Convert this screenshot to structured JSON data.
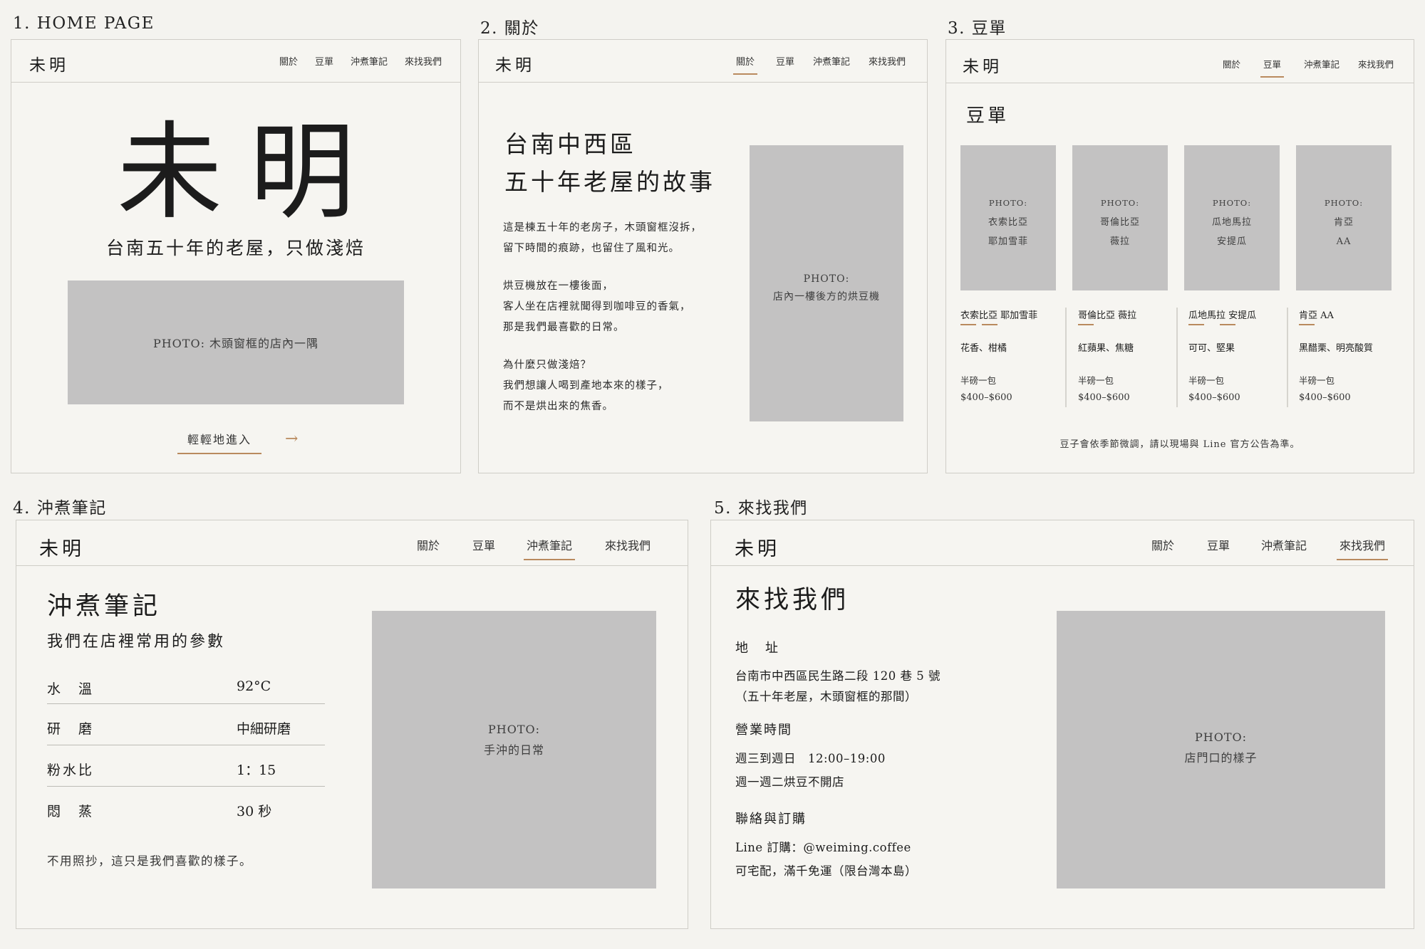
{
  "accent_color": "#b98a5e",
  "photo_color": "#c3c2c2",
  "panels": {
    "home": {
      "title": "1. HOME PAGE",
      "logo": "未明",
      "nav": [
        "關於",
        "豆單",
        "沖煮筆記",
        "來找我們"
      ],
      "hero_title": "未明",
      "hero_subtitle": "台南五十年的老屋，只做淺焙",
      "photo": "PHOTO: 木頭窗框的店內一隅",
      "enter_link": "輕輕地進入",
      "arrow_icon": "→"
    },
    "about": {
      "title": "2. 關於",
      "logo": "未明",
      "nav": [
        "關於",
        "豆單",
        "沖煮筆記",
        "來找我們"
      ],
      "heading": [
        "台南中西區",
        "五十年老屋的故事"
      ],
      "paragraphs": [
        [
          "這是棟五十年的老房子，木頭窗框沒拆，",
          "留下時間的痕跡，也留住了風和光。"
        ],
        [
          "烘豆機放在一樓後面，",
          "客人坐在店裡就聞得到咖啡豆的香氣，",
          "那是我們最喜歡的日常。"
        ],
        [
          "為什麼只做淺焙？",
          "我們想讓人喝到產地本來的樣子，",
          "而不是烘出來的焦香。"
        ]
      ],
      "photo": [
        "PHOTO:",
        "店內一樓後方的烘豆機"
      ]
    },
    "beans": {
      "title": "3. 豆單",
      "logo": "未明",
      "nav": [
        "關於",
        "豆單",
        "沖煮筆記",
        "來找我們"
      ],
      "heading": "豆單",
      "items": [
        {
          "photo": [
            "PHOTO:",
            "衣索比亞",
            "耶加雪菲"
          ],
          "name": "衣索比亞 耶加雪菲",
          "notes": "花香、柑橘",
          "size": "半磅一包",
          "price": "$400–$600"
        },
        {
          "photo": [
            "PHOTO:",
            "哥倫比亞",
            "薇拉"
          ],
          "name": "哥倫比亞 薇拉",
          "notes": "紅蘋果、焦糖",
          "size": "半磅一包",
          "price": "$400–$600"
        },
        {
          "photo": [
            "PHOTO:",
            "瓜地馬拉",
            "安提瓜"
          ],
          "name": "瓜地馬拉 安提瓜",
          "notes": "可可、堅果",
          "size": "半磅一包",
          "price": "$400–$600"
        },
        {
          "photo": [
            "PHOTO:",
            "肯亞",
            "AA"
          ],
          "name": "肯亞 AA",
          "notes": "黑醋栗、明亮酸質",
          "size": "半磅一包",
          "price": "$400–$600"
        }
      ],
      "footnote": "豆子會依季節微調，請以現場與 Line 官方公告為準。"
    },
    "notes": {
      "title": "4. 沖煮筆記",
      "logo": "未明",
      "nav": [
        "關於",
        "豆單",
        "沖煮筆記",
        "來找我們"
      ],
      "heading": "沖煮筆記",
      "subheading": "我們在店裡常用的參數",
      "params": [
        {
          "label": "水　溫",
          "value": "92°C"
        },
        {
          "label": "研　磨",
          "value": "中細研磨"
        },
        {
          "label": "粉水比",
          "value": "1：15"
        },
        {
          "label": "悶　蒸",
          "value": "30 秒"
        }
      ],
      "footnote": "不用照抄，這只是我們喜歡的樣子。",
      "photo": [
        "PHOTO:",
        "手沖的日常"
      ]
    },
    "contact": {
      "title": "5. 來找我們",
      "logo": "未明",
      "nav": [
        "關於",
        "豆單",
        "沖煮筆記",
        "來找我們"
      ],
      "heading": "來找我們",
      "address_label": "地　址",
      "address": [
        "台南市中西區民生路二段 120 巷 5 號",
        "（五十年老屋，木頭窗框的那間）"
      ],
      "hours_label": "營業時間",
      "hours": [
        "週三到週日　12:00–19:00",
        "週一週二烘豆不開店"
      ],
      "contact_label": "聯絡與訂購",
      "contact": [
        "Line 訂購：@weiming.coffee",
        "可宅配，滿千免運（限台灣本島）"
      ],
      "photo": [
        "PHOTO:",
        "店門口的樣子"
      ]
    }
  }
}
